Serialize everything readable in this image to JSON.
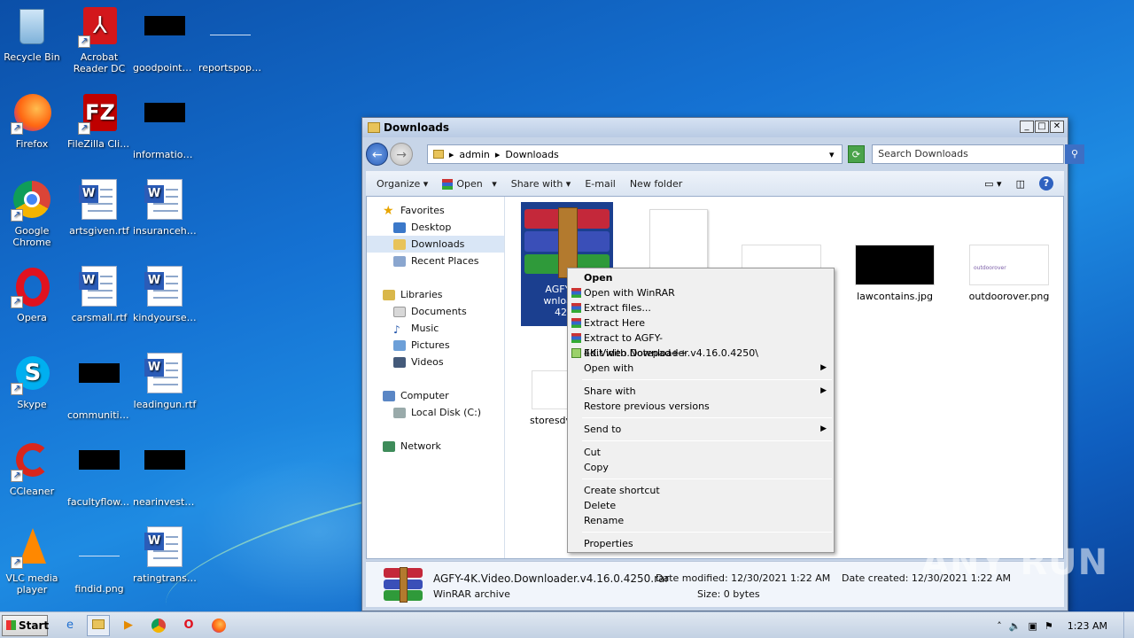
{
  "desktop": {
    "icons": [
      {
        "label": "Recycle Bin"
      },
      {
        "label": "Acrobat Reader DC"
      },
      {
        "label": "goodpoints...."
      },
      {
        "label": "reportspopu..."
      },
      {
        "label": "Firefox"
      },
      {
        "label": "FileZilla Client"
      },
      {
        "label": "information...."
      },
      {
        "label": "Google Chrome"
      },
      {
        "label": "artsgiven.rtf"
      },
      {
        "label": "insuranceh e..."
      },
      {
        "label": "Opera"
      },
      {
        "label": "carsmall.rtf"
      },
      {
        "label": "kindyourself..."
      },
      {
        "label": "Skype"
      },
      {
        "label": "communitie..."
      },
      {
        "label": "leadingun.rtf"
      },
      {
        "label": "CCleaner"
      },
      {
        "label": "facultyflow...."
      },
      {
        "label": "nearinvestm..."
      },
      {
        "label": "VLC media player"
      },
      {
        "label": "findid.png"
      },
      {
        "label": "ratingtransf..."
      }
    ]
  },
  "window": {
    "title": "Downloads",
    "address": {
      "segments": [
        "admin",
        "Downloads"
      ]
    },
    "search_placeholder": "Search Downloads",
    "toolbar": {
      "organize": "Organize",
      "open": "Open",
      "share": "Share with",
      "email": "E-mail",
      "new_folder": "New folder"
    },
    "nav": {
      "favorites": "Favorites",
      "desktop": "Desktop",
      "downloads": "Downloads",
      "recent": "Recent Places",
      "libraries": "Libraries",
      "documents": "Documents",
      "music": "Music",
      "pictures": "Pictures",
      "videos": "Videos",
      "computer": "Computer",
      "local_disk": "Local Disk (C:)",
      "network": "Network"
    },
    "files": {
      "selected_label_1": "AGFY-4K.",
      "selected_label_2": "wnloader.",
      "selected_label_3": "4250",
      "lawcontains": "lawcontains.jpg",
      "outdoorover": "outdoorover.png",
      "outdoorover_thumb": "outdoorover",
      "storesdv": "storesdv"
    },
    "status": {
      "filename": "AGFY-4K.Video.Downloader.v4.16.0.4250.rar",
      "type": "WinRAR archive",
      "modified": "Date modified: 12/30/2021 1:22 AM",
      "created": "Date created: 12/30/2021 1:22 AM",
      "size": "Size: 0 bytes"
    }
  },
  "context_menu": {
    "open": "Open",
    "open_winrar": "Open with WinRAR",
    "extract_files": "Extract files...",
    "extract_here": "Extract Here",
    "extract_to": "Extract to AGFY-4K.Video.Downloader.v4.16.0.4250\\",
    "notepad": "Edit with Notepad++",
    "open_with": "Open with",
    "share_with": "Share with",
    "restore": "Restore previous versions",
    "send_to": "Send to",
    "cut": "Cut",
    "copy": "Copy",
    "create_shortcut": "Create shortcut",
    "delete": "Delete",
    "rename": "Rename",
    "properties": "Properties"
  },
  "taskbar": {
    "start": "Start",
    "clock": "1:23 AM"
  },
  "watermark": "ANY RUN"
}
